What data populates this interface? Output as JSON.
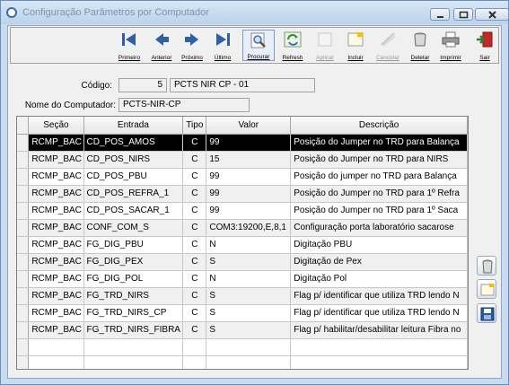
{
  "window": {
    "title": "Configuração Parâmetros por Computador"
  },
  "toolbar": {
    "buttons": [
      {
        "label": "Primeiro",
        "icon": "first-record-icon",
        "enabled": true
      },
      {
        "label": "Anterior",
        "icon": "previous-record-icon",
        "enabled": true
      },
      {
        "label": "Próximo",
        "icon": "next-record-icon",
        "enabled": true
      },
      {
        "label": "Último",
        "icon": "last-record-icon",
        "enabled": true
      },
      {
        "label": "Procurar",
        "icon": "search-icon",
        "enabled": true
      },
      {
        "label": "Refresh",
        "icon": "refresh-icon",
        "enabled": true
      },
      {
        "label": "Aplicar",
        "icon": "apply-icon",
        "enabled": false
      },
      {
        "label": "Incluir",
        "icon": "add-icon",
        "enabled": true
      },
      {
        "label": "Cancelar",
        "icon": "cancel-icon",
        "enabled": false
      },
      {
        "label": "Deletar",
        "icon": "delete-icon",
        "enabled": true
      },
      {
        "label": "Imprimir",
        "icon": "printer-icon",
        "enabled": true
      },
      {
        "label": "Sair",
        "icon": "exit-icon",
        "enabled": true
      }
    ]
  },
  "form": {
    "codigo_label": "Código:",
    "codigo_value": "5",
    "codigo_desc": "PCTS NIR CP - 01",
    "computador_label": "Nome do Computador:",
    "computador_value": "PCTS-NIR-CP"
  },
  "grid": {
    "headers": [
      "Seção",
      "Entrada",
      "Tipo",
      "Valor",
      "Descrição"
    ],
    "rows": [
      [
        "RCMP_BAC",
        "CD_POS_AMOS",
        "C",
        "99",
        "Posição do Jumper no TRD para Balança"
      ],
      [
        "RCMP_BAC",
        "CD_POS_NIRS",
        "C",
        "15",
        "Posição do Jumper no TRD para NIRS"
      ],
      [
        "RCMP_BAC",
        "CD_POS_PBU",
        "C",
        "99",
        "Posição do jumper no TRD para Balança"
      ],
      [
        "RCMP_BAC",
        "CD_POS_REFRA_1",
        "C",
        "99",
        "Posição do Jumper no TRD para 1º Refra"
      ],
      [
        "RCMP_BAC",
        "CD_POS_SACAR_1",
        "C",
        "99",
        "Posição do Jumper no TRD para 1º Saca"
      ],
      [
        "RCMP_BAC",
        "CONF_COM_S",
        "C",
        "COM3:19200,E,8,1",
        "Configuração porta laboratório sacarose"
      ],
      [
        "RCMP_BAC",
        "FG_DIG_PBU",
        "C",
        "N",
        "Digitação PBU"
      ],
      [
        "RCMP_BAC",
        "FG_DIG_PEX",
        "C",
        "S",
        "Digitação de Pex"
      ],
      [
        "RCMP_BAC",
        "FG_DIG_POL",
        "C",
        "N",
        "Digitação Pol"
      ],
      [
        "RCMP_BAC",
        "FG_TRD_NIRS",
        "C",
        "S",
        "Flag p/ identificar que utiliza TRD lendo N"
      ],
      [
        "RCMP_BAC",
        "FG_TRD_NIRS_CP",
        "C",
        "S",
        "Flag p/ identificar que utiliza TRD lendo N"
      ],
      [
        "RCMP_BAC",
        "FG_TRD_NIRS_FIBRA",
        "C",
        "S",
        "Flag p/ habilitar/desabilitar leitura Fibra no"
      ]
    ],
    "selected_row": 0
  },
  "side_buttons": [
    {
      "icon": "trash-can-icon"
    },
    {
      "icon": "new-record-icon"
    },
    {
      "icon": "save-disk-icon"
    }
  ],
  "colors": {
    "window_frame": "#bcd3ea",
    "selected_row": "#000000",
    "alt_row": "#f0f0f0"
  }
}
